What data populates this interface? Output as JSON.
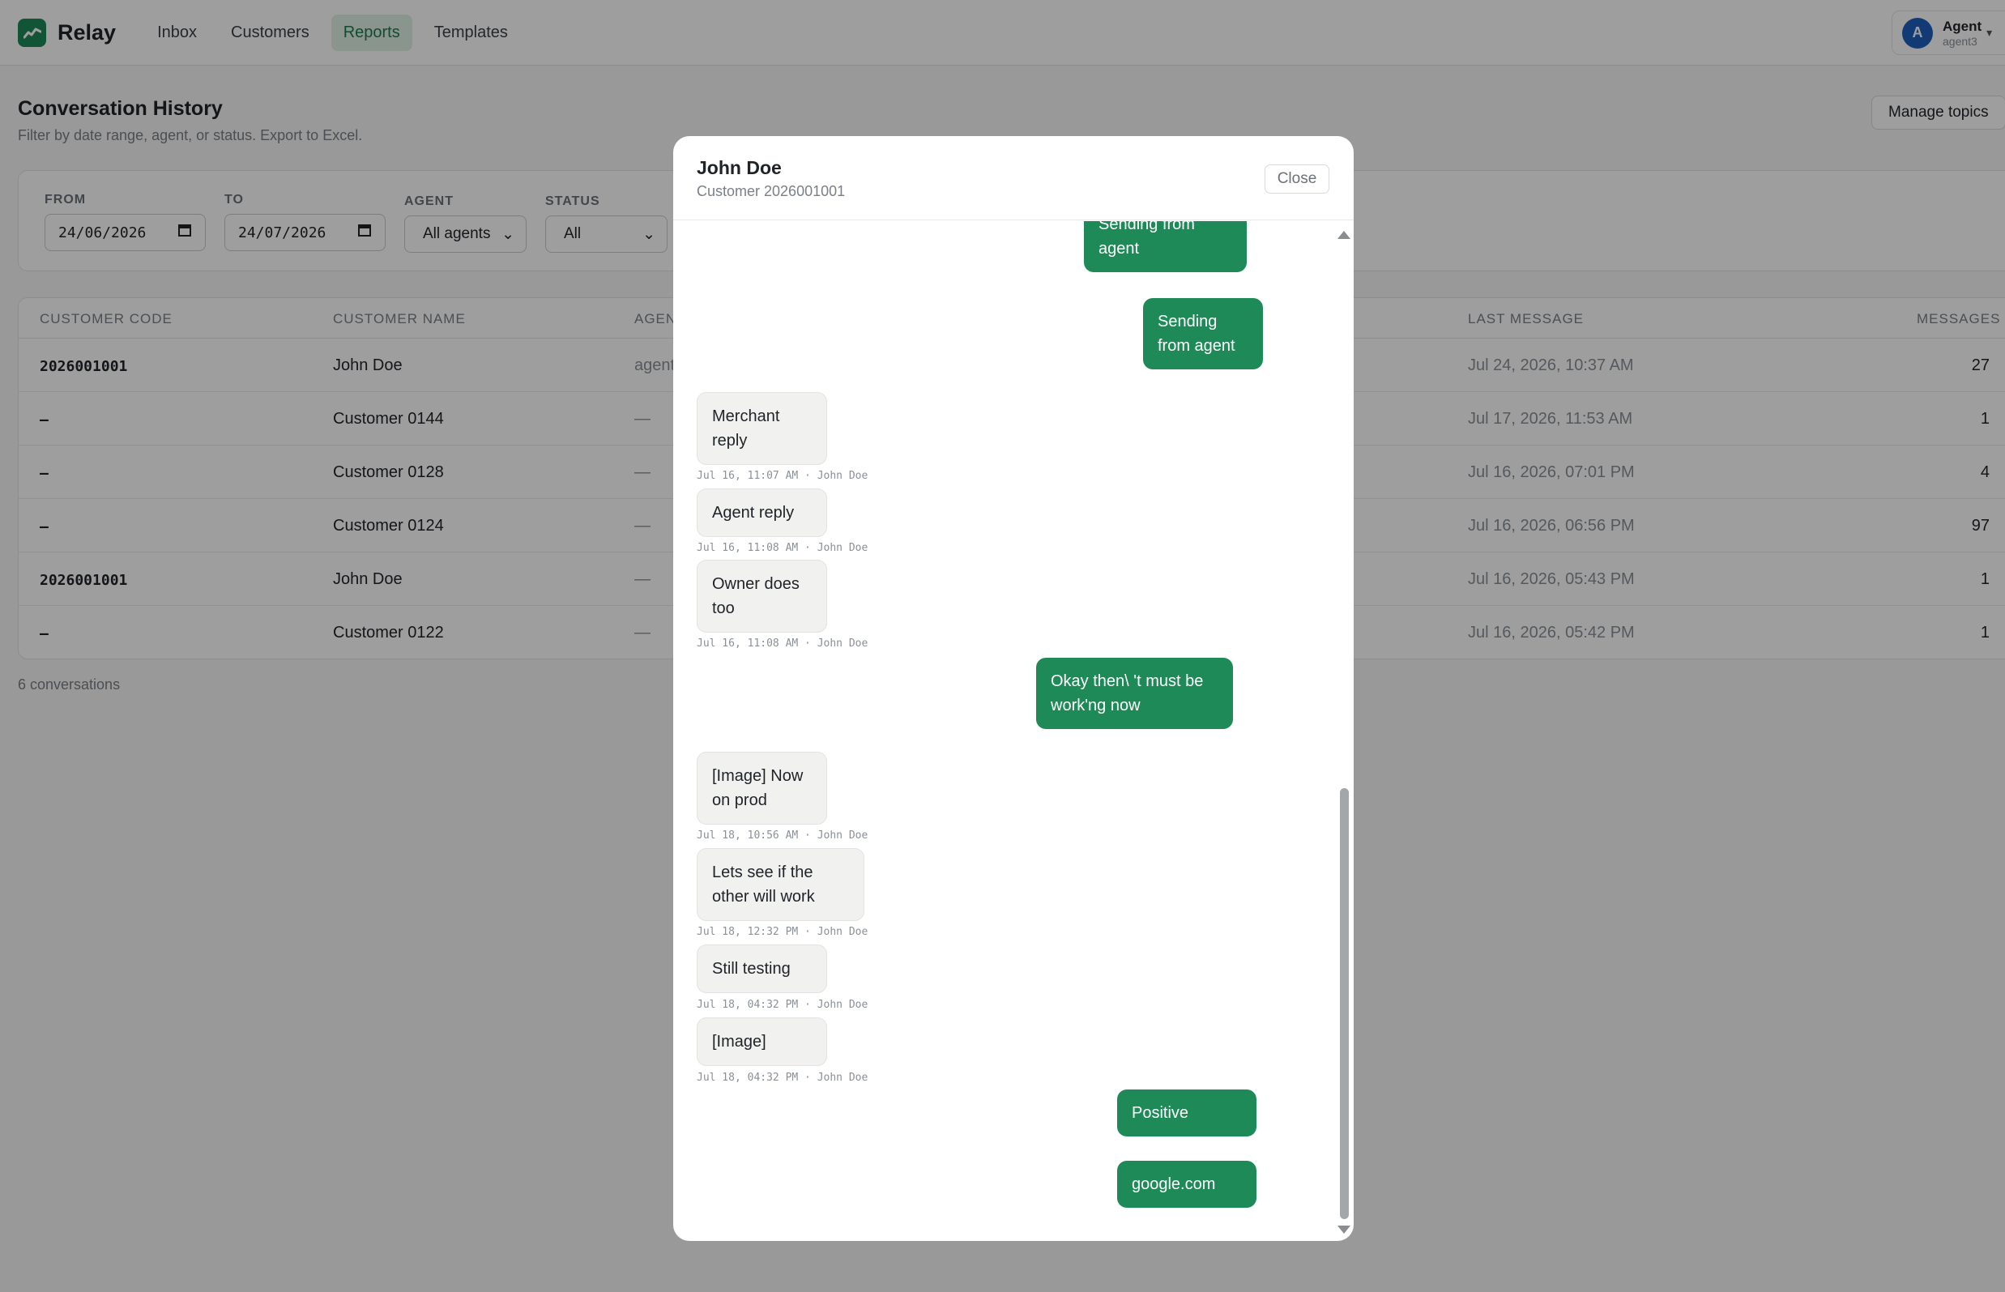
{
  "app": {
    "name": "Relay"
  },
  "nav": {
    "items": [
      {
        "label": "Inbox",
        "active": false
      },
      {
        "label": "Customers",
        "active": false
      },
      {
        "label": "Reports",
        "active": true
      },
      {
        "label": "Templates",
        "active": false
      }
    ]
  },
  "user": {
    "avatar_letter": "A",
    "name": "Agent",
    "username": "agent3"
  },
  "page": {
    "title": "Conversation History",
    "subtitle": "Filter by date range, agent, or status. Export to Excel.",
    "manage_topics_label": "Manage topics"
  },
  "filters": {
    "from_label": "FROM",
    "from_value": "24/06/2026",
    "to_label": "TO",
    "to_value": "24/07/2026",
    "agent_label": "AGENT",
    "agent_value": "All agents",
    "status_label": "STATUS",
    "status_value": "All"
  },
  "table": {
    "headers": {
      "customer_code": "CUSTOMER CODE",
      "customer_name": "CUSTOMER NAME",
      "agent": "AGEN",
      "last_message": "LAST MESSAGE",
      "messages": "MESSAGES"
    },
    "rows": [
      {
        "code": "2026001001",
        "name": "John Doe",
        "agent": "agent",
        "last": "Jul 24, 2026, 10:37 AM",
        "count": "27"
      },
      {
        "code": "–",
        "name": "Customer 0144",
        "agent": "—",
        "last": "Jul 17, 2026, 11:53 AM",
        "count": "1"
      },
      {
        "code": "–",
        "name": "Customer 0128",
        "agent": "—",
        "last": "Jul 16, 2026, 07:01 PM",
        "count": "4"
      },
      {
        "code": "–",
        "name": "Customer 0124",
        "agent": "—",
        "last": "Jul 16, 2026, 06:56 PM",
        "count": "97"
      },
      {
        "code": "2026001001",
        "name": "John Doe",
        "agent": "—",
        "last": "Jul 16, 2026, 05:43 PM",
        "count": "1"
      },
      {
        "code": "–",
        "name": "Customer 0122",
        "agent": "—",
        "last": "Jul 16, 2026, 05:42 PM",
        "count": "1"
      }
    ],
    "count_text": "6 conversations"
  },
  "modal": {
    "title": "John Doe",
    "subtitle": "Customer 2026001001",
    "close_label": "Close",
    "messages": [
      {
        "dir": "out",
        "text": "Sending from agent"
      },
      {
        "dir": "out",
        "text": "Sending from agent"
      },
      {
        "dir": "in",
        "text": "Merchant reply",
        "meta": "Jul 16, 11:07 AM · John Doe"
      },
      {
        "dir": "in",
        "text": "Agent reply",
        "meta": "Jul 16, 11:08 AM · John Doe"
      },
      {
        "dir": "in",
        "text": "Owner does too",
        "meta": "Jul 16, 11:08 AM · John Doe"
      },
      {
        "dir": "out",
        "text": "Okay then\\ 't must be work'ng now"
      },
      {
        "dir": "in",
        "text": "[Image] Now on prod",
        "meta": "Jul 18, 10:56 AM · John Doe"
      },
      {
        "dir": "in",
        "text": "Lets see if the other will work",
        "meta": "Jul 18, 12:32 PM · John Doe"
      },
      {
        "dir": "in",
        "text": "Still testing",
        "meta": "Jul 18, 04:32 PM · John Doe"
      },
      {
        "dir": "in",
        "text": "[Image]",
        "meta": "Jul 18, 04:32 PM · John Doe"
      },
      {
        "dir": "out",
        "text": "Positive"
      },
      {
        "dir": "out",
        "text": "google.com"
      }
    ]
  },
  "colors": {
    "accent": "#1d8a57",
    "avatar": "#1e5fbf",
    "active_nav_bg": "#dff1e6"
  }
}
